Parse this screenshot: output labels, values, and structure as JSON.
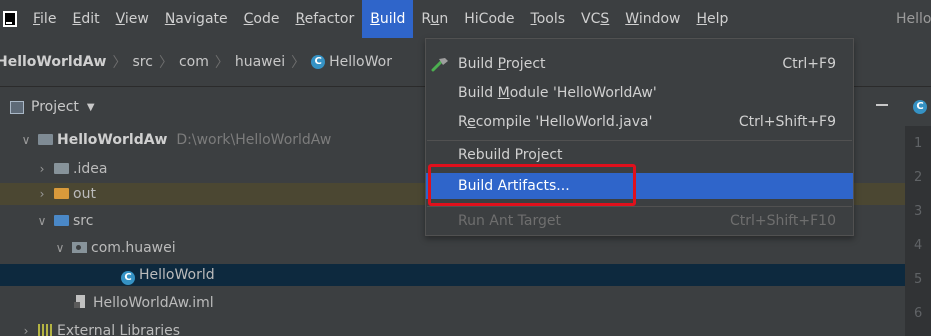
{
  "menubar": {
    "items": [
      {
        "pre": "",
        "mn": "F",
        "post": "ile"
      },
      {
        "pre": "",
        "mn": "E",
        "post": "dit"
      },
      {
        "pre": "",
        "mn": "V",
        "post": "iew"
      },
      {
        "pre": "",
        "mn": "N",
        "post": "avigate"
      },
      {
        "pre": "",
        "mn": "C",
        "post": "ode"
      },
      {
        "pre": "",
        "mn": "R",
        "post": "efactor"
      },
      {
        "pre": "",
        "mn": "B",
        "post": "uild"
      },
      {
        "pre": "R",
        "mn": "u",
        "post": "n"
      },
      {
        "pre": "HiCode",
        "mn": "",
        "post": ""
      },
      {
        "pre": "",
        "mn": "T",
        "post": "ools"
      },
      {
        "pre": "VC",
        "mn": "S",
        "post": ""
      },
      {
        "pre": "",
        "mn": "W",
        "post": "indow"
      },
      {
        "pre": "",
        "mn": "H",
        "post": "elp"
      }
    ],
    "title_truncated": "Hello"
  },
  "breadcrumb": {
    "project": "HelloWorldAw",
    "src": "src",
    "com": "com",
    "huawei": "huawei",
    "file": "HelloWor"
  },
  "project_panel": {
    "title": "Project",
    "tree": {
      "root_name": "HelloWorldAw",
      "root_path": "D:\\work\\HelloWorldAw",
      "idea": ".idea",
      "out": "out",
      "src": "src",
      "package": "com.huawei",
      "class": "HelloWorld",
      "iml": "HelloWorldAw.iml",
      "libs": "External Libraries"
    }
  },
  "build_menu": {
    "build_project": {
      "pre": "Build ",
      "mn": "P",
      "post": "roject",
      "shortcut": "Ctrl+F9"
    },
    "build_module": {
      "pre": "Build ",
      "mn": "M",
      "post": "odule 'HelloWorldAw'"
    },
    "recompile": {
      "pre": "R",
      "mn": "e",
      "post": "compile 'HelloWorld.java'",
      "shortcut": "Ctrl+Shift+F9"
    },
    "rebuild": {
      "pre": "Rebuild Pro",
      "mn": "j",
      "post": "ect"
    },
    "build_artifacts": "Build Artifacts...",
    "run_ant": {
      "label": "Run Ant Target",
      "shortcut": "Ctrl+Shift+F10"
    }
  },
  "gutter": [
    "1",
    "2",
    "3",
    "4",
    "5",
    "6"
  ],
  "colors": {
    "menu_highlight": "#2f65ca",
    "red_box": "#e0101c",
    "class_icon": "#3592c4",
    "out_folder": "#d99a3b",
    "src_folder": "#4a88c7"
  }
}
